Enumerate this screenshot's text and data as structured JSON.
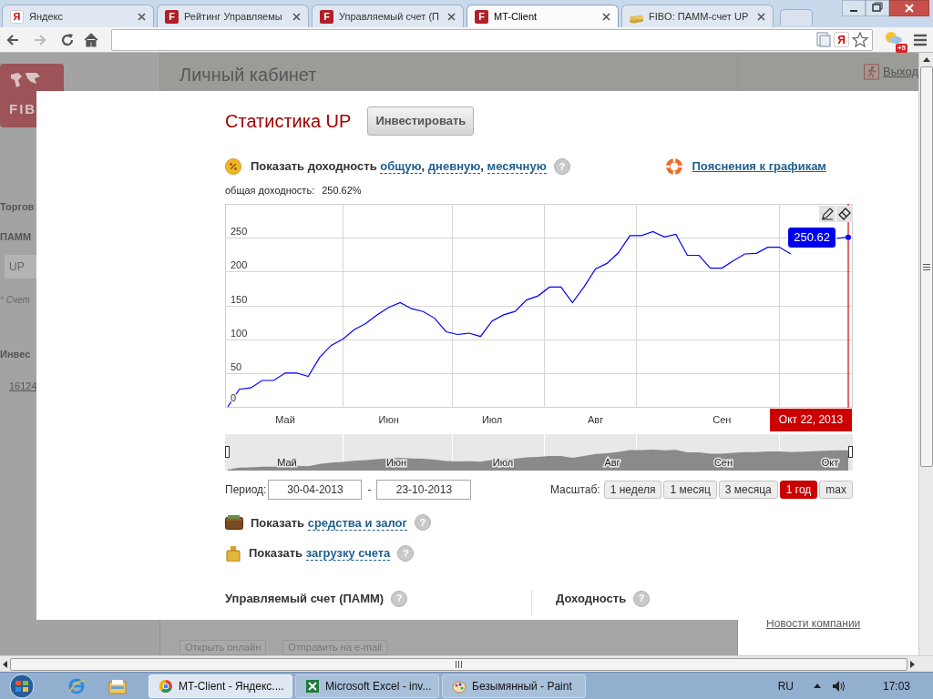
{
  "browser": {
    "tabs": [
      {
        "label": "Яндекс",
        "selected": false,
        "icon": {
          "kind": "yandex",
          "text": "Я"
        }
      },
      {
        "label": "Рейтинг Управляемы",
        "selected": false,
        "icon": {
          "kind": "fibo",
          "text": "F"
        }
      },
      {
        "label": "Управляемый счет (П",
        "selected": false,
        "icon": {
          "kind": "fibo",
          "text": "F"
        }
      },
      {
        "label": "MT-Client",
        "selected": true,
        "icon": {
          "kind": "fibo",
          "text": "F"
        }
      },
      {
        "label": "FIBO: ПАММ-счет UP",
        "selected": false,
        "icon": {
          "kind": "coins"
        }
      }
    ],
    "toolbar": {
      "yandex_mark": "Я",
      "weather_badge": "+5"
    }
  },
  "background_page": {
    "logo_text": "FIB",
    "title": "Личный кабинет",
    "logout": "Выход",
    "sidebar": [
      {
        "kind": "heading",
        "text": "Торгов"
      },
      {
        "kind": "heading",
        "text": "ПАММ"
      },
      {
        "kind": "tab",
        "text": "UP"
      },
      {
        "kind": "note",
        "text": "° Счет"
      },
      {
        "kind": "heading",
        "text": "Инвес"
      },
      {
        "kind": "link",
        "text": "16124"
      }
    ],
    "buttons": [
      "Открыть онлайн",
      "Отправить на e-mail"
    ],
    "news_link": "Новости компании"
  },
  "modal": {
    "title": "Статистика UP",
    "invest_button": "Инвестировать",
    "yield_row": {
      "prefix": "Показать доходность",
      "links": [
        "общую",
        "дневную",
        "месячную"
      ],
      "separator": ",",
      "help_mark": "?"
    },
    "explain_link": "Пояснения к графикам",
    "total_label": "общая доходность:",
    "total_value": "250.62%",
    "chart": {
      "tooltip": "250.62",
      "date_tag": "Окт 22, 2013",
      "chart_data": {
        "type": "line",
        "grid": true,
        "ylim": [
          0,
          300
        ],
        "yticks": [
          0,
          50,
          100,
          150,
          200,
          250
        ],
        "categories": [
          null,
          null,
          null,
          null,
          null,
          "Май",
          null,
          null,
          null,
          null,
          null,
          null,
          null,
          null,
          "Июн",
          null,
          null,
          null,
          null,
          null,
          null,
          null,
          null,
          "Июл",
          null,
          null,
          null,
          null,
          null,
          null,
          null,
          null,
          "Авг",
          null,
          null,
          null,
          null,
          null,
          null,
          null,
          null,
          null,
          null,
          "Сен",
          null,
          null,
          null,
          null,
          null,
          null,
          null,
          null,
          null,
          null,
          null
        ],
        "series": [
          {
            "color": "#0000ff",
            "values": [
              0,
              26,
              28,
              39,
              39,
              50,
              50,
              45,
              73,
              91,
              100,
              114,
              123,
              136,
              147,
              154,
              145,
              141,
              131,
              111,
              107,
              109,
              104,
              127,
              136,
              141,
              158,
              164,
              177,
              177,
              154,
              177,
              204,
              212,
              228,
              253,
              253,
              259,
              251,
              255,
              224,
              224,
              205,
              205,
              216,
              226,
              227,
              236,
              236,
              226,
              null,
              null,
              null,
              249,
              250.62
            ]
          }
        ]
      }
    },
    "navigator": {
      "labels": [
        "Май",
        "Июн",
        "Июл",
        "Авг",
        "Сен",
        "Окт"
      ]
    },
    "period": {
      "label": "Период:",
      "from": "30-04-2013",
      "separator": "-",
      "to": "23-10-2013"
    },
    "scale": {
      "label": "Масштаб:",
      "options": [
        {
          "label": "1 неделя",
          "selected": false
        },
        {
          "label": "1 месяц",
          "selected": false
        },
        {
          "label": "3 месяца",
          "selected": false
        },
        {
          "label": "1 год",
          "selected": true
        },
        {
          "label": "max",
          "selected": false
        }
      ]
    },
    "show_rows": [
      {
        "kind": "wallet",
        "prefix": "Показать",
        "link": "средства и залог",
        "help_mark": "?"
      },
      {
        "kind": "weight",
        "prefix": "Показать",
        "link": "загрузку счета",
        "help_mark": "?"
      }
    ],
    "sections": [
      {
        "title": "Управляемый счет (ПАММ)",
        "help_mark": "?"
      },
      {
        "title": "Доходность",
        "help_mark": "?"
      }
    ]
  },
  "taskbar": {
    "items": [
      {
        "kind": "browser",
        "label": "MT-Client - Яндекс....",
        "selected": true
      },
      {
        "kind": "excel",
        "label": "Microsoft Excel - inv...",
        "selected": false
      },
      {
        "kind": "paint",
        "label": "Безымянный - Paint",
        "selected": false
      }
    ],
    "language": "RU",
    "time": "17:03"
  }
}
